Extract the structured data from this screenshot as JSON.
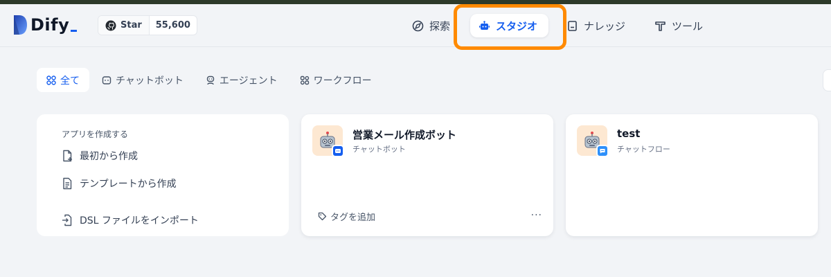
{
  "header": {
    "logo": {
      "text": "Dify"
    },
    "github": {
      "star_label": "Star",
      "star_count": "55,600"
    },
    "nav": [
      {
        "label": "探索",
        "icon": "compass-icon"
      },
      {
        "label": "スタジオ",
        "icon": "robot-icon",
        "active": true
      },
      {
        "label": "ナレッジ",
        "icon": "book-icon"
      },
      {
        "label": "ツール",
        "icon": "hammer-icon"
      }
    ]
  },
  "filter_tabs": [
    {
      "label": "全て",
      "icon": "grid-icon",
      "active": true
    },
    {
      "label": "チャットボット",
      "icon": "chat-bubble-icon"
    },
    {
      "label": "エージェント",
      "icon": "agent-icon"
    },
    {
      "label": "ワークフロー",
      "icon": "workflow-icon"
    }
  ],
  "create_card": {
    "title": "アプリを作成する",
    "items": [
      {
        "label": "最初から作成",
        "icon": "file-plus-icon"
      },
      {
        "label": "テンプレートから作成",
        "icon": "file-template-icon"
      },
      {
        "label": "DSL ファイルをインポート",
        "icon": "file-import-icon"
      }
    ]
  },
  "apps": [
    {
      "name": "営業メール作成ボット",
      "type": "チャットボット",
      "tag_label": "タグを追加",
      "more": "···",
      "icon": "robot-emoji",
      "badge_color": "#155eef"
    },
    {
      "name": "test",
      "type": "チャットフロー",
      "icon": "robot-emoji",
      "badge_color": "#2e90fa"
    }
  ],
  "colors": {
    "accent": "#155eef",
    "highlight": "#ff8a00"
  }
}
